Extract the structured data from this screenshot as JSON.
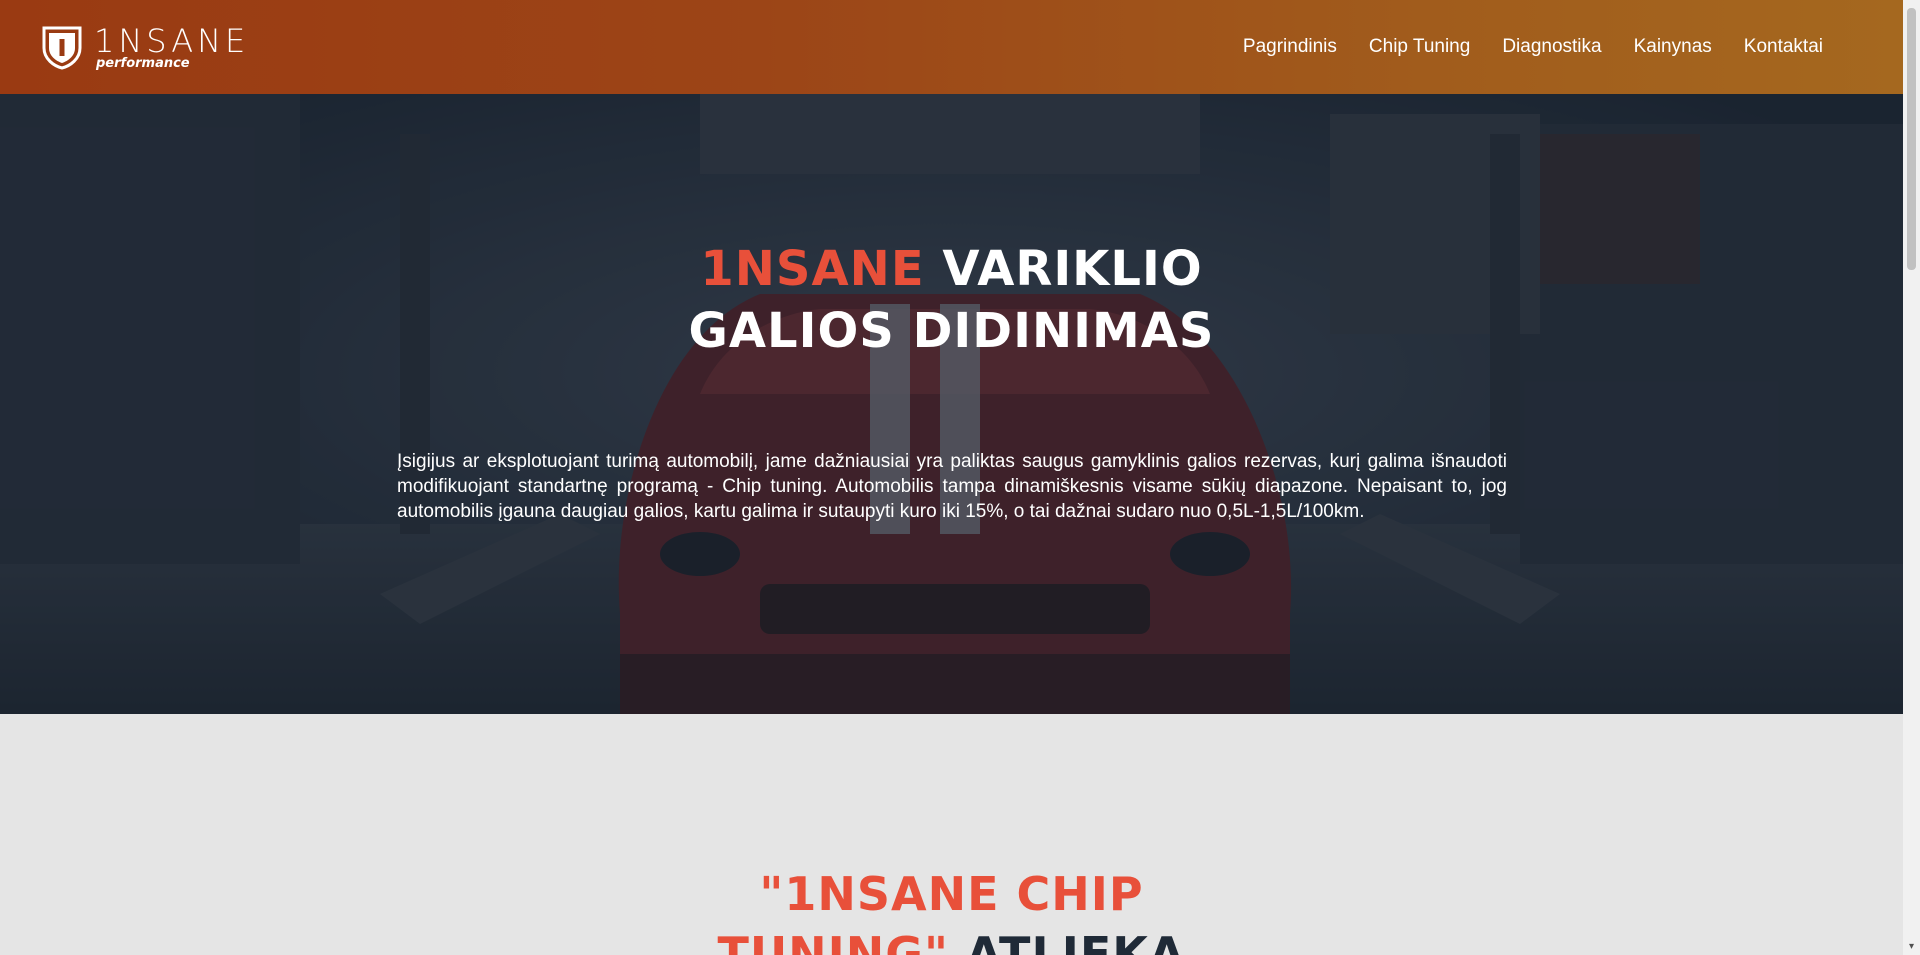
{
  "header": {
    "logo": {
      "main": "1NSANE",
      "sub": "performance"
    },
    "nav": [
      {
        "label": "Pagrindinis"
      },
      {
        "label": "Chip Tuning"
      },
      {
        "label": "Diagnostika"
      },
      {
        "label": "Kainynas"
      },
      {
        "label": "Kontaktai"
      }
    ]
  },
  "hero": {
    "title_accent": "1NSANE",
    "title_line1_rest": " VARIKLIO",
    "title_line2": "GALIOS DIDINIMAS",
    "paragraph": "Įsigijus ar eksplotuojant turimą automobilį, jame dažniausiai yra paliktas saugus gamyklinis galios rezervas, kurį galima išnaudoti modifikuojant standartnę programą - Chip tuning. Automobilis tampa dinamiškesnis visame sūkių diapazone. Nepaisant to, jog automobilis įgauna daugiau galios, kartu galima ir sutaupyti kuro iki 15%, o tai dažnai sudaro nuo 0,5L-1,5L/100km."
  },
  "section2": {
    "title_accent_line1": "\"1NSANE CHIP",
    "title_accent_line2": "TUNING\"",
    "title_rest": " ATLIEKA"
  },
  "colors": {
    "accent": "#e8503a",
    "header_start": "#9a3a12",
    "header_end": "#a5681f",
    "dark_text": "#1f2a37",
    "section_bg": "#e5e5e5"
  },
  "icons": {
    "logo": "shield-logo-icon",
    "scroll_down": "scroll-down-arrow-icon"
  }
}
